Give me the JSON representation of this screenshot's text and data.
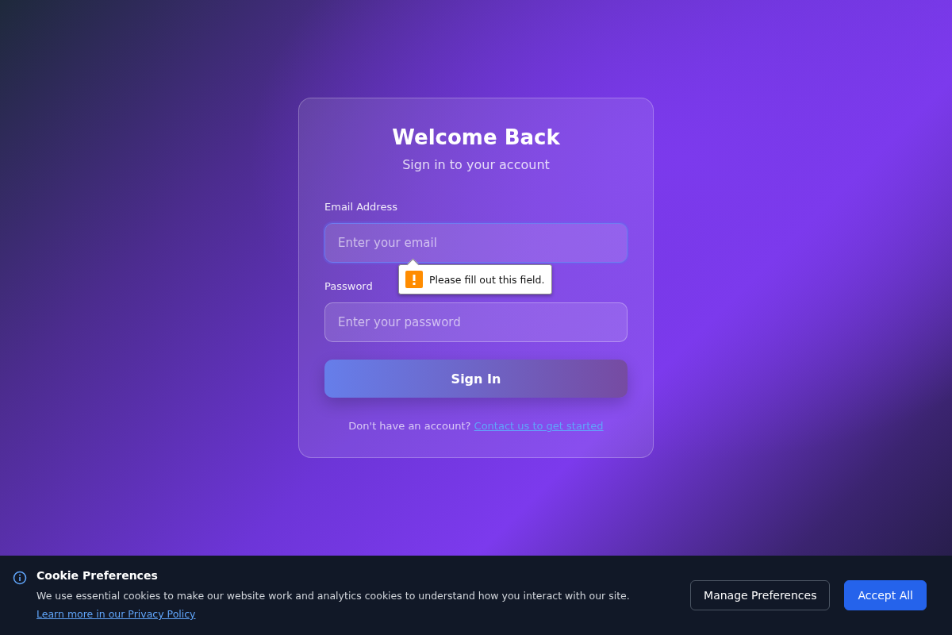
{
  "login": {
    "title": "Welcome Back",
    "subtitle": "Sign in to your account",
    "fields": [
      {
        "label": "Email Address",
        "placeholder": "Enter your email",
        "focused": true
      },
      {
        "label": "Password",
        "placeholder": "Enter your password",
        "focused": false
      }
    ],
    "validation_tooltip": {
      "text": "Please fill out this field."
    },
    "submit": "Sign In",
    "footer": {
      "text": "Don't have an account?",
      "link": "Contact us to get started"
    }
  },
  "cookie_banner": {
    "title": "Cookie Preferences",
    "text": "We use essential cookies to make our website work and analytics cookies to understand how you interact with our site.",
    "link": "Learn more in our Privacy Policy",
    "buttons": [
      {
        "label": "Manage Preferences",
        "kind": "secondary"
      },
      {
        "label": "Accept All",
        "kind": "primary"
      }
    ]
  }
}
